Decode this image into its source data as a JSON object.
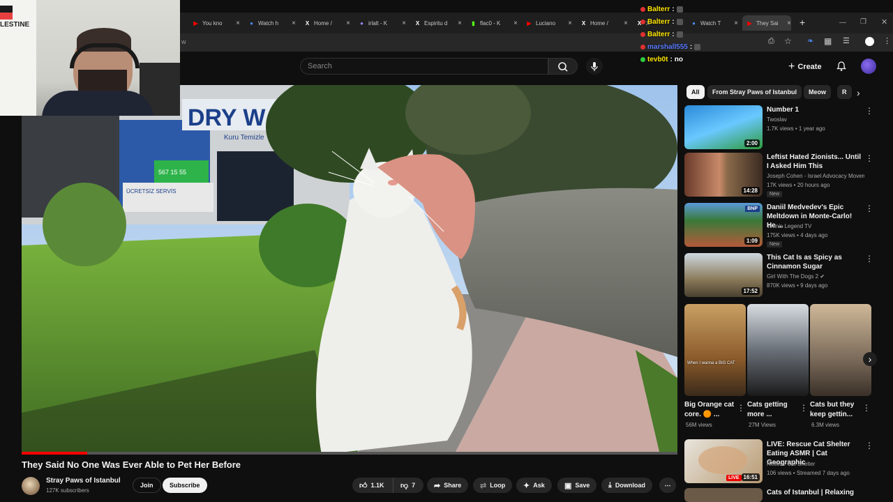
{
  "browser": {
    "tabs": [
      {
        "label": "You kno",
        "fav": "▶",
        "fav_color": "#ff0000"
      },
      {
        "label": "Watch h",
        "fav": "●",
        "fav_color": "#4a8af4"
      },
      {
        "label": "Home / ",
        "fav": "X",
        "fav_color": "#ffffff"
      },
      {
        "label": "irlalt - K",
        "fav": "●",
        "fav_color": "#9b8af4"
      },
      {
        "label": "Espiritu d",
        "fav": "X",
        "fav_color": "#ffffff"
      },
      {
        "label": "flac0 - K",
        "fav": "▮",
        "fav_color": "#53fc18"
      },
      {
        "label": "Luciano",
        "fav": "▶",
        "fav_color": "#ff0000"
      },
      {
        "label": "Home / ",
        "fav": "X",
        "fav_color": "#ffffff"
      },
      {
        "label": "X",
        "fav": "X",
        "fav_color": "#ffffff"
      },
      {
        "label": "Watch T",
        "fav": "●",
        "fav_color": "#4a8af4"
      },
      {
        "label": "They Sai",
        "fav": "▶",
        "fav_color": "#ff0000",
        "active": true
      }
    ],
    "new_tab": "+",
    "address_fragment": "w"
  },
  "chat": [
    {
      "user": "Balterr",
      "sep": ":",
      "msg": "",
      "color": "#ffe600"
    },
    {
      "user": "Balterr",
      "sep": ":",
      "msg": "",
      "color": "#ffe600"
    },
    {
      "user": "Balterr",
      "sep": ":",
      "msg": "",
      "color": "#ffe600"
    },
    {
      "user": "marshall555",
      "sep": ":",
      "msg": "",
      "color": "#5b7cff"
    },
    {
      "user": "tevb0t",
      "sep": ":",
      "msg": "no",
      "color": "#ffe600"
    }
  ],
  "webcam": {
    "sign_text": "LESTINE"
  },
  "header": {
    "search_placeholder": "Search",
    "create_label": "Create"
  },
  "chips": [
    {
      "label": "All",
      "selected": true
    },
    {
      "label": "From Stray Paws of Istanbul",
      "selected": false
    },
    {
      "label": "Meow",
      "selected": false
    },
    {
      "label": "R",
      "selected": false
    }
  ],
  "video": {
    "title": "They Said No One Was Ever Able to Pet Her Before",
    "channel": "Stray Paws of Istanbul",
    "subscribers": "127K subscribers",
    "join_label": "Join",
    "subscribe_label": "Subscribe",
    "likes": "1.1K",
    "dislikes": "7",
    "share_label": "Share",
    "loop_label": "Loop",
    "ask_label": "Ask",
    "save_label": "Save",
    "download_label": "Download",
    "store_sign": "DRY W",
    "store_sub": "Kuru Temizle",
    "phone": "567 15 55",
    "banner": "ÜCRETSİZ SERVİS"
  },
  "recommended": [
    {
      "title": "Number 1",
      "channel": "Twoslav",
      "meta": "1.7K views • 1 year ago",
      "duration": "2:00",
      "new": false
    },
    {
      "title": "Leftist Hated Zionists... Until I Asked Him This",
      "channel": "Joseph Cohen - Israel Advocacy Movem...",
      "meta": "17K views • 20 hours ago",
      "duration": "14:28",
      "new": true
    },
    {
      "title": "Daniil Medvedev's Epic Meltdown in Monte-Carlo! He ...",
      "channel": "Tennis Legend TV",
      "meta": "175K views • 4 days ago",
      "duration": "1:09",
      "new": true
    },
    {
      "title": "This Cat Is as Spicy as Cinnamon Sugar",
      "channel": "Girl With The Dogs 2 ✔",
      "meta": "870K views • 9 days ago",
      "duration": "17:52",
      "new": false
    }
  ],
  "new_label": "New",
  "shorts": [
    {
      "title": "Big Orange cat core. 🟠 ...",
      "views": "56M views",
      "caption": "When I wanna a BIG CAT"
    },
    {
      "title": "Cats getting more ...",
      "views": "27M Views",
      "caption": ""
    },
    {
      "title": "Cats but they keep gettin...",
      "views": "6.3M views",
      "caption": ""
    }
  ],
  "live_item": {
    "title": "LIVE: Rescue Cat Shelter Eating ASMR | Cat Geographic",
    "channel": "Rescue Cat Shelter",
    "meta": "106 views • Streamed 7 days ago",
    "badge": "LIVE",
    "duration": "16:51"
  },
  "last_item_title": "Cats of Istanbul | Relaxing",
  "bbc_badge": "BNP",
  "colors": {
    "accent": "#ff0000",
    "bg": "#0f0f0f",
    "chip": "#272727"
  }
}
